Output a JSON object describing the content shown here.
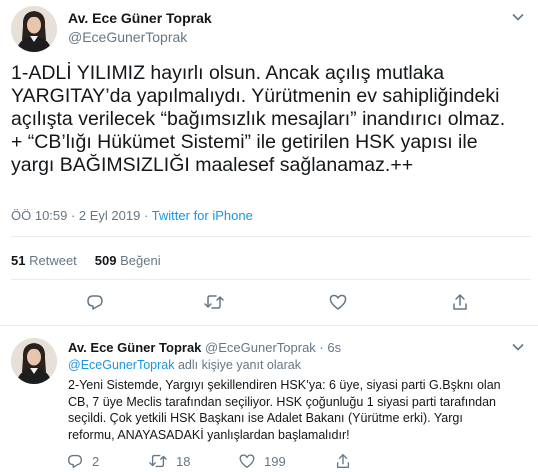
{
  "main_tweet": {
    "author": {
      "name": "Av. Ece Güner Toprak",
      "handle": "@EceGunerToprak"
    },
    "text_lines": [
      "1-ADLİ YILIMIZ hayırlı olsun. Ancak açılış mutlaka",
      "YARGITAY’da yapılmalıydı. Yürütmenin ev sahipliğindeki",
      "açılışta verilecek “bağımsızlık mesajları” inandırıcı olmaz.",
      "+ “CB’lığı Hükümet Sistemi” ile getirilen HSK yapısı ile",
      "yargı BAĞIMSIZLIĞI maalesef sağlanamaz.++"
    ],
    "timestamp": "ÖÖ 10:59 · 2 Eyl 2019 · ",
    "source": "Twitter for iPhone",
    "retweets": {
      "count": "51",
      "label": "Retweet"
    },
    "likes": {
      "count": "509",
      "label": "Beğeni"
    },
    "icons": [
      "chevron-down-icon",
      "reply-icon",
      "retweet-icon",
      "like-icon",
      "share-icon"
    ]
  },
  "reply_tweet": {
    "author": {
      "name": "Av. Ece Güner Toprak",
      "handle": "@EceGunerToprak",
      "separator": "·",
      "time": "6s"
    },
    "replying_to": {
      "mention": "@EceGunerToprak",
      "suffix": " adlı kişiye yanıt olarak"
    },
    "text_lines": [
      "2-Yeni Sistemde, Yargıyı şekillendiren HSK’ya: 6 üye, siyasi parti G.Bşknı olan",
      "CB, 7 üye Meclis tarafından seçiliyor. HSK çoğunluğu 1 siyasi parti tarafından",
      "seçildi. Çok yetkili HSK Başkanı ise Adalet Bakanı (Yürütme erki). Yargı",
      "reformu, ANAYASADAKİ yanlışlardan başlamalıdır!"
    ],
    "reply_count": "2",
    "retweet_count": "18",
    "like_count": "199"
  },
  "colors": {
    "accent": "#1b95e0",
    "secondary_text": "#657786",
    "border": "#e6ecf0"
  }
}
